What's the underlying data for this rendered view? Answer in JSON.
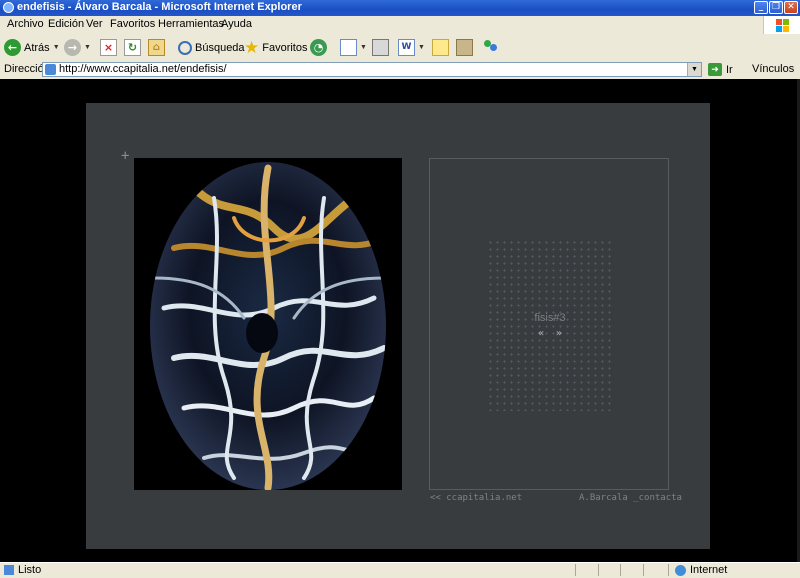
{
  "window": {
    "title": "endefisis - Álvaro Barcala - Microsoft Internet Explorer",
    "buttons": [
      "_",
      "❐",
      "✕"
    ]
  },
  "menubar": [
    "Archivo",
    "Edición",
    "Ver",
    "Favoritos",
    "Herramientas",
    "Ayuda"
  ],
  "toolbar": {
    "back_label": "Atrás",
    "search_label": "Búsqueda",
    "favorites_label": "Favoritos"
  },
  "address": {
    "label": "Dirección",
    "url": "http://www.ccapitalia.net/endefisis/",
    "go_label": "Ir",
    "links_label": "Vínculos"
  },
  "page": {
    "crosshair": "+",
    "piece_title": "fisis#3",
    "prev": "«",
    "next": "»",
    "footer_left": "<< ccapitalia.net",
    "footer_right": "A.Barcala _contacta"
  },
  "status": {
    "text": "Listo",
    "zone": "Internet"
  },
  "colors": {
    "panel": "#393c3f",
    "background": "#000000",
    "text_muted": "#7e8287"
  }
}
